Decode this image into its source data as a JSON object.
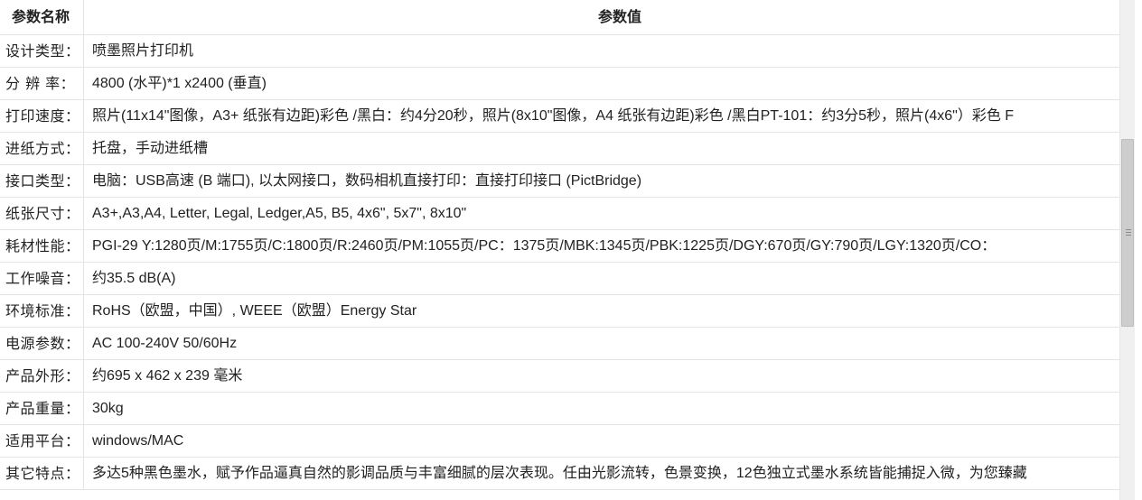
{
  "table": {
    "header": {
      "name": "参数名称",
      "value": "参数值"
    },
    "rows": [
      {
        "name": "设计类型：",
        "value": "喷墨照片打印机"
      },
      {
        "name": "分 辨 率：",
        "value": "4800 (水平)*1 x2400 (垂直)"
      },
      {
        "name": "打印速度：",
        "value": "照片(11x14\"图像，A3+ 纸张有边距)彩色 /黑白：约4分20秒，照片(8x10\"图像，A4 纸张有边距)彩色 /黑白PT-101：约3分5秒，照片(4x6\"）彩色 F"
      },
      {
        "name": "进纸方式：",
        "value": "托盘，手动进纸槽"
      },
      {
        "name": "接口类型：",
        "value": "电脑：USB高速 (B 端口), 以太网接口，数码相机直接打印：直接打印接口 (PictBridge)"
      },
      {
        "name": "纸张尺寸：",
        "value": "A3+,A3,A4, Letter, Legal, Ledger,A5, B5, 4x6\", 5x7\", 8x10\""
      },
      {
        "name": "耗材性能：",
        "value": "PGI-29 Y:1280页/M:1755页/C:1800页/R:2460页/PM:1055页/PC：1375页/MBK:1345页/PBK:1225页/DGY:670页/GY:790页/LGY:1320页/CO："
      },
      {
        "name": "工作噪音：",
        "value": "约35.5 dB(A)"
      },
      {
        "name": "环境标准：",
        "value": "RoHS（欧盟，中国）, WEEE（欧盟）Energy Star"
      },
      {
        "name": "电源参数：",
        "value": "AC 100-240V 50/60Hz"
      },
      {
        "name": "产品外形：",
        "value": "约695 x 462 x 239 毫米"
      },
      {
        "name": "产品重量：",
        "value": "30kg"
      },
      {
        "name": "适用平台：",
        "value": "windows/MAC"
      },
      {
        "name": "其它特点：",
        "value": "多达5种黑色墨水，赋予作品逼真自然的影调品质与丰富细腻的层次表现。任由光影流转，色景变换，12色独立式墨水系统皆能捕捉入微，为您臻藏"
      }
    ]
  }
}
